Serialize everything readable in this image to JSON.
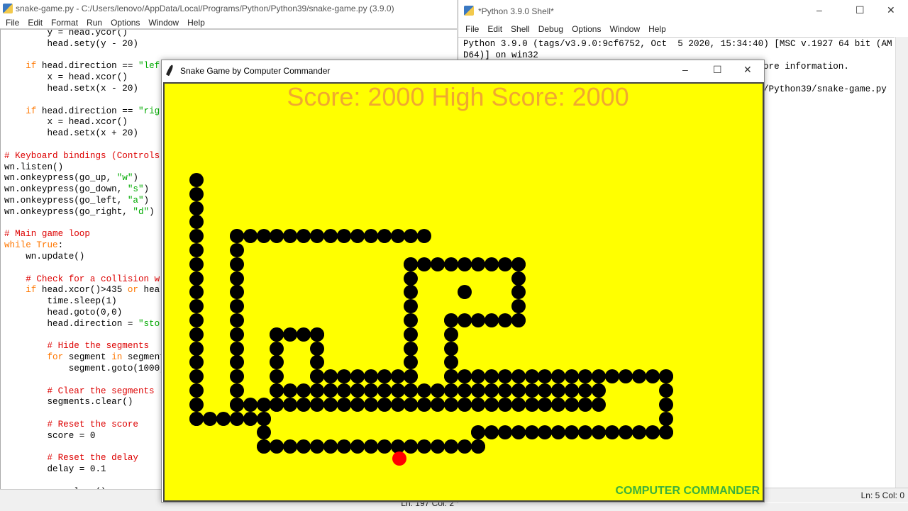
{
  "editor": {
    "title": "snake-game.py - C:/Users/lenovo/AppData/Local/Programs/Python/Python39/snake-game.py (3.9.0)",
    "menu": [
      "File",
      "Edit",
      "Format",
      "Run",
      "Options",
      "Window",
      "Help"
    ],
    "code_lines": [
      "        y = head.ycor()",
      "        head.sety(y - 20)",
      "",
      "    if head.direction == \"lef",
      "        x = head.xcor()",
      "        head.setx(x - 20)",
      "",
      "    if head.direction == \"rig",
      "        x = head.xcor()",
      "        head.setx(x + 20)",
      "",
      "# Keyboard bindings (Controls",
      "wn.listen()",
      "wn.onkeypress(go_up, \"w\")",
      "wn.onkeypress(go_down, \"s\")",
      "wn.onkeypress(go_left, \"a\")",
      "wn.onkeypress(go_right, \"d\")",
      "",
      "# Main game loop",
      "while True:",
      "    wn.update()",
      "",
      "    # Check for a collision w",
      "    if head.xcor()>435 or hea",
      "        time.sleep(1)",
      "        head.goto(0,0)",
      "        head.direction = \"sto",
      "",
      "        # Hide the segments",
      "        for segment in segment",
      "            segment.goto(1000,",
      "",
      "        # Clear the segments",
      "        segments.clear()",
      "",
      "        # Reset the score",
      "        score = 0",
      "",
      "        # Reset the delay",
      "        delay = 0.1",
      "",
      "        pen.clear()"
    ],
    "status": "Ln: 197   Col: 2"
  },
  "shell": {
    "title": "*Python 3.9.0 Shell*",
    "menu": [
      "File",
      "Edit",
      "Shell",
      "Debug",
      "Options",
      "Window",
      "Help"
    ],
    "lines": [
      "Python 3.9.0 (tags/v3.9.0:9cf6752, Oct  5 2020, 15:34:40) [MSC v.1927 64 bit (AM",
      "D64)] on win32"
    ],
    "partial_lines": [
      "ore information.",
      "/Python39/snake-game.py"
    ],
    "status": "Ln: 5   Col: 0"
  },
  "game": {
    "title": "Snake Game by Computer Commander",
    "score_text": "Score: 2000  High Score: 2000",
    "score": 2000,
    "high_score": 2000,
    "brand": "COMPUTER COMMANDER",
    "colors": {
      "background": "#ffff00",
      "snake": "#000000",
      "food": "#ff0000",
      "score": "#f0a830",
      "brand": "#3cb03c"
    }
  },
  "window_controls": {
    "minimize": "–",
    "maximize": "☐",
    "close": "✕"
  }
}
